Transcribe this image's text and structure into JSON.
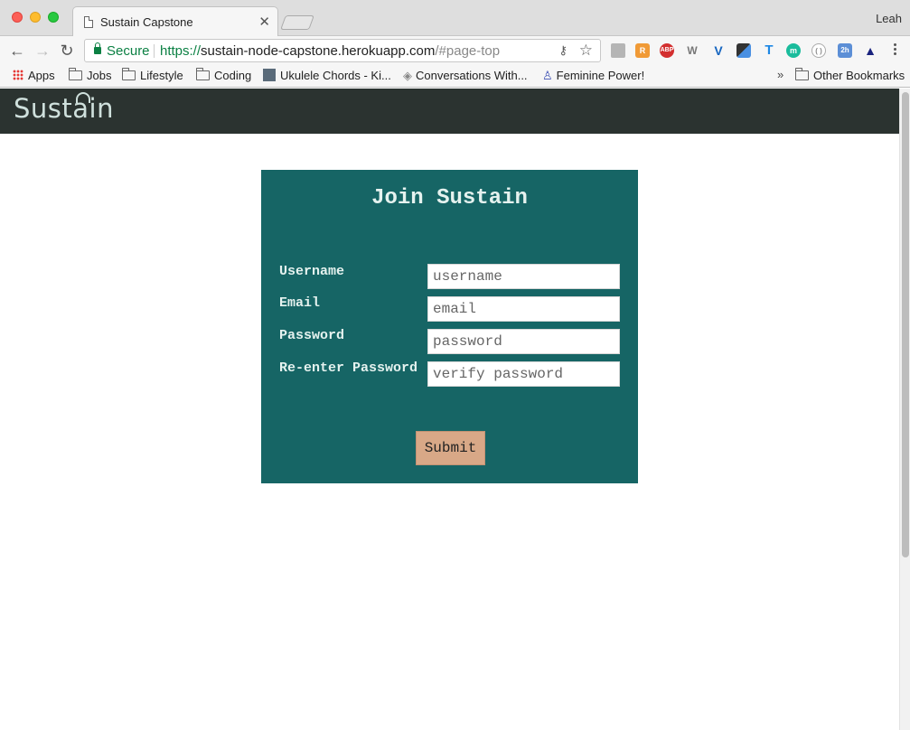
{
  "browser": {
    "tab_title": "Sustain Capstone",
    "profile_name": "Leah",
    "secure_label": "Secure",
    "url_scheme": "https://",
    "url_host": "sustain-node-capstone.herokuapp.com",
    "url_path": "/#page-top",
    "extensions": [
      "drive-icon",
      "reader-icon",
      "adblock-icon",
      "wappalyzer-icon",
      "vue-icon",
      "eyedropper-icon",
      "typography-icon",
      "mercury-icon",
      "json-icon",
      "calendar-icon",
      "deploy-icon"
    ],
    "bookmarks": {
      "apps": "Apps",
      "items": [
        "Jobs",
        "Lifestyle",
        "Coding",
        "Ukulele Chords - Ki...",
        "Conversations With...",
        "Feminine Power!"
      ],
      "overflow": "»",
      "other": "Other Bookmarks"
    }
  },
  "site": {
    "logo_text": "Sustain",
    "brand_color": "#166565",
    "header_color": "#2b3330"
  },
  "form": {
    "title": "Join Sustain",
    "fields": [
      {
        "label": "Username",
        "placeholder": "username"
      },
      {
        "label": "Email",
        "placeholder": "email"
      },
      {
        "label": "Password",
        "placeholder": "password"
      },
      {
        "label": "Re-enter Password",
        "placeholder": "verify password"
      }
    ],
    "submit_label": "Submit"
  }
}
